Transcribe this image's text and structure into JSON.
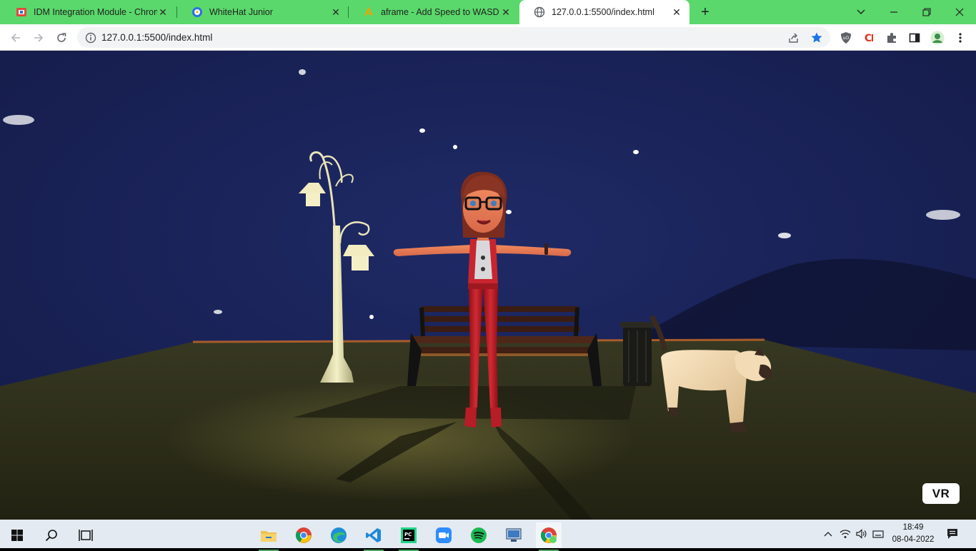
{
  "tabs": [
    {
      "title": "IDM Integration Module - Chrom",
      "favicon": "idm-icon",
      "active": false
    },
    {
      "title": "WhiteHat Junior",
      "favicon": "whitehat-icon",
      "active": false
    },
    {
      "title": "aframe - Add Speed to WASD Co",
      "favicon": "aframe-icon",
      "active": false
    },
    {
      "title": "127.0.0.1:5500/index.html",
      "favicon": "globe-icon",
      "active": true
    }
  ],
  "toolbar": {
    "url": "127.0.0.1:5500/index.html"
  },
  "scene": {
    "vr_label": "VR"
  },
  "taskbar": {
    "apps": [
      "File Explorer",
      "Google Chrome",
      "Microsoft Edge",
      "Visual Studio Code",
      "PyCharm",
      "Zoom",
      "Spotify",
      "Remote Desktop",
      "Google Chrome"
    ],
    "time": "18:49",
    "date": "08-04-2022"
  },
  "colors": {
    "tabstrip": "#5ad86b",
    "sky": "#1a2356",
    "ground": "#2c2d1a"
  }
}
